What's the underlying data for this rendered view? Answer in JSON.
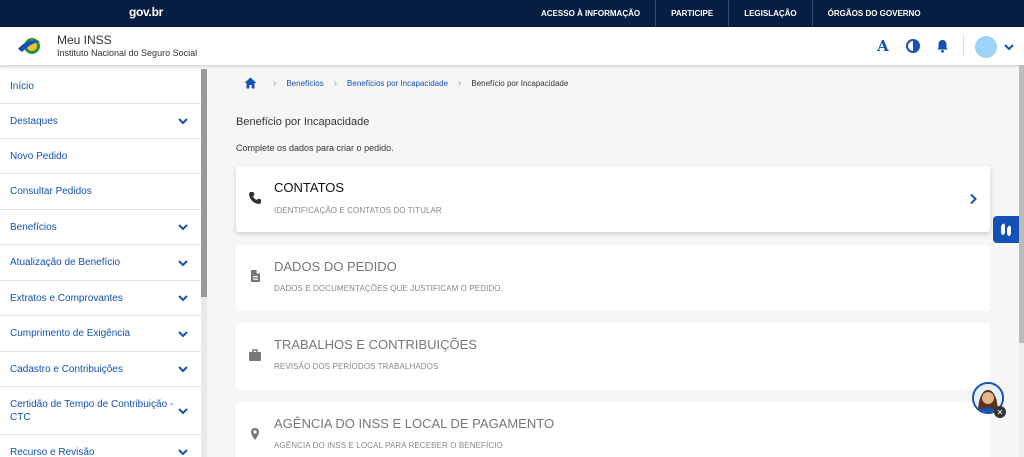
{
  "govbar": {
    "logo": "gov.br",
    "links": [
      "ACESSO À INFORMAÇÃO",
      "PARTICIPE",
      "LEGISLAÇÃO",
      "ÓRGÃOS DO GOVERNO"
    ]
  },
  "header": {
    "title": "Meu INSS",
    "subtitle": "Instituto Nacional do Seguro Social",
    "font_button": "A"
  },
  "sidebar": {
    "items": [
      {
        "label": "Início",
        "expandable": false
      },
      {
        "label": "Destaques",
        "expandable": true
      },
      {
        "label": "Novo Pedido",
        "expandable": false
      },
      {
        "label": "Consultar Pedidos",
        "expandable": false
      },
      {
        "label": "Benefícios",
        "expandable": true
      },
      {
        "label": "Atualização de Benefício",
        "expandable": true
      },
      {
        "label": "Extratos e Comprovantes",
        "expandable": true
      },
      {
        "label": "Cumprimento de Exigência",
        "expandable": true
      },
      {
        "label": "Cadastro e Contribuições",
        "expandable": true
      },
      {
        "label": "Certidão de Tempo de Contribuição - CTC",
        "expandable": true
      },
      {
        "label": "Recurso e Revisão",
        "expandable": true
      }
    ]
  },
  "breadcrumb": {
    "items": [
      "Benefícios",
      "Benefícios por Incapacidade",
      "Benefício por Incapacidade"
    ]
  },
  "main": {
    "title": "Benefício por Incapacidade",
    "description": "Complete os dados para criar o pedido."
  },
  "cards": [
    {
      "title": "CONTATOS",
      "subtitle": "IDENTIFICAÇÃO E CONTATOS DO TITULAR",
      "icon": "phone-icon",
      "state": "active"
    },
    {
      "title": "DADOS DO PEDIDO",
      "subtitle": "DADOS E DOCUMENTAÇÕES QUE JUSTIFICAM O PEDIDO.",
      "icon": "document-icon",
      "state": "disabled"
    },
    {
      "title": "TRABALHOS E CONTRIBUIÇÕES",
      "subtitle": "REVISÃO DOS PERÍODOS TRABALHADOS",
      "icon": "briefcase-icon",
      "state": "disabled"
    },
    {
      "title": "AGÊNCIA DO INSS E LOCAL DE PAGAMENTO",
      "subtitle": "AGÊNCIA DO INSS E LOCAL PARA RECEBER O BENEFÍCIO",
      "icon": "location-pin-icon",
      "state": "disabled"
    }
  ],
  "colors": {
    "govbar_bg": "#071d41",
    "accent": "#1351b4",
    "avatar": "#9dd3f6"
  }
}
